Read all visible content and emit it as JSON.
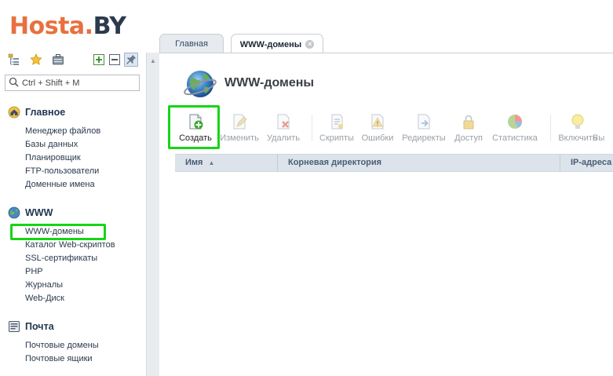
{
  "app": {
    "logo_part1": "Hosta.",
    "logo_part2": "BY"
  },
  "sidebar_toolbar": {
    "icons": [
      "tree-icon",
      "star-icon",
      "briefcase-icon",
      "expand-icon",
      "collapse-icon",
      "pin-icon"
    ]
  },
  "search": {
    "placeholder": "Ctrl + Shift + M"
  },
  "sidebar": {
    "sections": [
      {
        "title": "Главное",
        "icon": "home-icon",
        "items": [
          "Менеджер файлов",
          "Базы данных",
          "Планировщик",
          "FTP-пользователи",
          "Доменные имена"
        ]
      },
      {
        "title": "WWW",
        "icon": "globe-icon",
        "items": [
          "WWW-домены",
          "Каталог Web-скриптов",
          "SSL-сертификаты",
          "PHP",
          "Журналы",
          "Web-Диск"
        ]
      },
      {
        "title": "Почта",
        "icon": "mail-icon",
        "items": [
          "Почтовые домены",
          "Почтовые ящики"
        ]
      }
    ]
  },
  "tabs": [
    {
      "label": "Главная",
      "active": false
    },
    {
      "label": "WWW-домены",
      "active": true
    }
  ],
  "page": {
    "title": "WWW-домены"
  },
  "toolbar": {
    "buttons": [
      {
        "label": "Создать",
        "icon": "create-icon",
        "enabled": true
      },
      {
        "label": "Изменить",
        "icon": "edit-icon",
        "enabled": false
      },
      {
        "label": "Удалить",
        "icon": "delete-icon",
        "enabled": false
      },
      {
        "label": "Скрипты",
        "icon": "scripts-icon",
        "enabled": false
      },
      {
        "label": "Ошибки",
        "icon": "errors-icon",
        "enabled": false
      },
      {
        "label": "Редиректы",
        "icon": "redirects-icon",
        "enabled": false
      },
      {
        "label": "Доступ",
        "icon": "lock-icon",
        "enabled": false
      },
      {
        "label": "Статистика",
        "icon": "pie-chart-icon",
        "enabled": false
      },
      {
        "label": "Включить",
        "icon": "bulb-icon",
        "enabled": false
      },
      {
        "label": "Вы",
        "icon": "",
        "enabled": false
      }
    ]
  },
  "grid": {
    "columns": [
      {
        "label": "Имя",
        "sort": "asc"
      },
      {
        "label": "Корневая директория"
      },
      {
        "label": "IP-адреса"
      }
    ]
  },
  "colors": {
    "highlight": "#17d417",
    "brand_orange": "#e87040",
    "brand_dark": "#2d3a4e"
  }
}
